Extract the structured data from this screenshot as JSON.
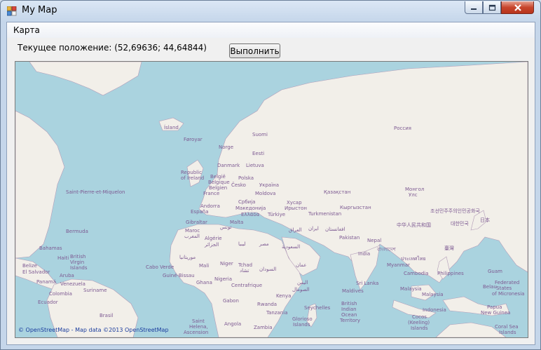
{
  "window": {
    "title": "My Map"
  },
  "menu": {
    "map_label": "Карта"
  },
  "status": {
    "position_text": "Текущее положение: (52,69636; 44,64844)"
  },
  "toolbar": {
    "run_label": "Выполнить"
  },
  "map": {
    "attribution": "© OpenStreetMap - Map data ©2013 OpenStreetMap",
    "colors": {
      "water": "#aad3df",
      "land": "#f2efe9",
      "border": "#b29cb8",
      "label": "#7d5a92"
    },
    "labels": {
      "island": "Ísland",
      "faroyar": "Føroyar",
      "norge": "Norge",
      "suomi": "Suomi",
      "eesti": "Eesti",
      "rossiya": "Россия",
      "danmark": "Danmark",
      "lietuva": "Lietuva",
      "ireland_1": "Republic",
      "ireland_2": "of Ireland",
      "belgie": "België",
      "belgique": "Belgique",
      "belgien": "Belgien",
      "polska": "Polska",
      "ukraina": "Україна",
      "france": "France",
      "cesko": "Česko",
      "moldova": "Moldova",
      "kazakhstan": "Қазақстан",
      "mongolia_1": "Монгол",
      "mongolia_2": "Улс",
      "saint_pierre": "Saint-Pierre-et-Miquelon",
      "andorra": "Andorra",
      "espana": "España",
      "srbija": "Србија",
      "makedonija": "Македонија",
      "ellada": "Ελλάδα",
      "turkiye": "Türkiye",
      "sakartvelo_1": "Хусар",
      "sakartvelo_2": "Ирыстон",
      "kyrgyzstan": "Кыргызстан",
      "turkmenistan": "Turkmenistan",
      "korea": "조선민주주의인민공화국",
      "japan": "日本",
      "gibraltar": "Gibraltar",
      "malta": "Malta",
      "tounes": "تونس",
      "bermuda": "Bermuda",
      "maroc_1": "Maroc",
      "maroc_2": "المغرب",
      "algerie_1": "Algérie",
      "algerie_2": "الجزائر",
      "libya": "ليبيا",
      "misr": "مصر",
      "iraq": "العراق",
      "iran": "ایران",
      "afghanistan": "افغانستان",
      "pakistan": "Pakistan",
      "nepal": "Nepal",
      "china": "中华人民共和国",
      "korea_south": "대한민국",
      "taiwan": "臺灣",
      "saudi": "السعودية",
      "bahamas": "Bahamas",
      "haiti": "Haiti",
      "bvi_1": "British",
      "bvi_2": "Virgin",
      "bvi_3": "Islands",
      "belize": "Belize",
      "el_salvador": "El Salvador",
      "mauritanie": "موريتانيا",
      "mali": "Mali",
      "niger": "Niger",
      "tchad_1": "Tchad",
      "tchad_2": "تشاد",
      "sudan": "السودان",
      "oman": "عمان",
      "india": "India",
      "bangladesh": "বাংলাদেশ",
      "myanmar": "Myanmar",
      "thailand": "ประเทศไทย",
      "cambodia": "Cambodia",
      "philippines": "Philippines",
      "guam": "Guam",
      "cabo_verde": "Cabo Verde",
      "guine_bissau": "Guiné-Bissau",
      "panama": "Panamá",
      "aruba": "Aruba",
      "venezuela": "Venezuela",
      "ghana": "Ghana",
      "nigeria": "Nigeria",
      "car": "Centrafrique",
      "yemen": "اليمن",
      "somalia": "الصومال",
      "maldives": "Maldives",
      "sri_lanka": "Sri Lanka",
      "malaysia_1": "Malaysia",
      "malaysia_2": "Malaysia",
      "belau": "Belau",
      "fsm_1": "Federated",
      "fsm_2": "States",
      "fsm_3": "of Micronesia",
      "colombia": "Colombia",
      "suriname": "Suriname",
      "ecuador": "Ecuador",
      "gabon": "Gabon",
      "kenya": "Kenya",
      "rwanda": "Rwanda",
      "seychelles": "Seychelles",
      "biot_1": "British",
      "biot_2": "Indian",
      "biot_3": "Ocean",
      "biot_4": "Territory",
      "indonesia": "Indonesia",
      "png_1": "Papua",
      "png_2": "New Guinea",
      "brasil": "Brasil",
      "tanzania": "Tanzania",
      "cocos_1": "Cocos",
      "cocos_2": "(Keeling)",
      "cocos_3": "Islands",
      "saint_helena_1": "Saint",
      "saint_helena_2": "Helena,",
      "saint_helena_3": "Ascension",
      "angola": "Angola",
      "zambia": "Zambia",
      "glorioso_1": "Glorioso",
      "glorioso_2": "Islands",
      "coral_sea_1": "Coral Sea",
      "coral_sea_2": "Islands"
    }
  }
}
